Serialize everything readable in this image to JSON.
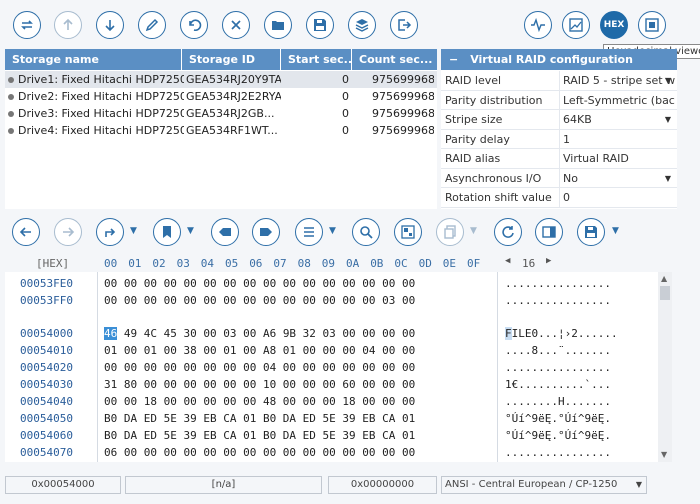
{
  "top_toolbar": {
    "tooltip": "Hexadecimal viewer",
    "hex_label": "HEX"
  },
  "drives": {
    "headers": [
      "Storage name",
      "Storage ID",
      "Start sec...",
      "Count sec..."
    ],
    "rows": [
      {
        "name": "Drive1: Fixed Hitachi HDP7250...",
        "id": "GEA534RJ20Y9TA",
        "start": "0",
        "count": "975699968"
      },
      {
        "name": "Drive2: Fixed Hitachi HDP7250...",
        "id": "GEA534RJ2E2RYA",
        "start": "0",
        "count": "975699968"
      },
      {
        "name": "Drive3: Fixed Hitachi HDP7250...",
        "id": "GEA534RJ2GB...",
        "start": "0",
        "count": "975699968"
      },
      {
        "name": "Drive4: Fixed Hitachi HDP7250...",
        "id": "GEA534RF1WT...",
        "start": "0",
        "count": "975699968"
      }
    ]
  },
  "raid_config": {
    "title": "Virtual RAID configuration",
    "collapse": "−",
    "props": [
      {
        "key": "RAID level",
        "value": "RAID 5 - stripe set w"
      },
      {
        "key": "Parity distribution",
        "value": "Left-Symmetric (bac"
      },
      {
        "key": "Stripe size",
        "value": "64KB"
      },
      {
        "key": "Parity delay",
        "value": "1"
      },
      {
        "key": "RAID alias",
        "value": "Virtual RAID"
      },
      {
        "key": "Asynchronous I/O",
        "value": "No"
      },
      {
        "key": "Rotation shift value",
        "value": "0"
      }
    ]
  },
  "hex_view": {
    "header_label": "[HEX]",
    "columns": [
      "00",
      "01",
      "02",
      "03",
      "04",
      "05",
      "06",
      "07",
      "08",
      "09",
      "0A",
      "0B",
      "0C",
      "0D",
      "0E",
      "0F"
    ],
    "bytes_per_row": "16",
    "rows": [
      {
        "addr": "00053FE0",
        "bytes": "00 00 00 00 00 00 00 00 00 00 00 00 00 00 00 00",
        "ascii": "................"
      },
      {
        "addr": "00053FF0",
        "bytes": "00 00 00 00 00 00 00 00 00 00 00 00 00 00 03 00",
        "ascii": "................"
      },
      {
        "addr": "00054000",
        "first": "46",
        "bytes": " 49 4C 45 30 00 03 00 A6 9B 32 03 00 00 00 00",
        "afirst": "F",
        "ascii": "ILE0...¦›2......"
      },
      {
        "addr": "00054010",
        "bytes": "01 00 01 00 38 00 01 00 A8 01 00 00 00 04 00 00",
        "ascii": "....8...¨......."
      },
      {
        "addr": "00054020",
        "bytes": "00 00 00 00 00 00 00 00 04 00 00 00 00 00 00 00",
        "ascii": "................"
      },
      {
        "addr": "00054030",
        "bytes": "31 80 00 00 00 00 00 00 10 00 00 00 60 00 00 00",
        "ascii": "1€..........`..."
      },
      {
        "addr": "00054040",
        "bytes": "00 00 18 00 00 00 00 00 48 00 00 00 18 00 00 00",
        "ascii": "........H......."
      },
      {
        "addr": "00054050",
        "bytes": "B0 DA ED 5E 39 EB CA 01 B0 DA ED 5E 39 EB CA 01",
        "ascii": "°Úí^9ëĘ.°Úí^9ëĘ."
      },
      {
        "addr": "00054060",
        "bytes": "B0 DA ED 5E 39 EB CA 01 B0 DA ED 5E 39 EB CA 01",
        "ascii": "°Úí^9ëĘ.°Úí^9ëĘ."
      },
      {
        "addr": "00054070",
        "bytes": "06 00 00 00 00 00 00 00 00 00 00 00 00 00 00 00",
        "ascii": "................"
      }
    ]
  },
  "status_bar": {
    "offset": "0x00054000",
    "selection": "[n/a]",
    "value": "0x00000000",
    "encoding": "ANSI - Central European / CP-1250"
  },
  "colors": {
    "accent": "#2e6fa8",
    "header_bg": "#5b8fc4",
    "selection": "#3b8fd6"
  }
}
